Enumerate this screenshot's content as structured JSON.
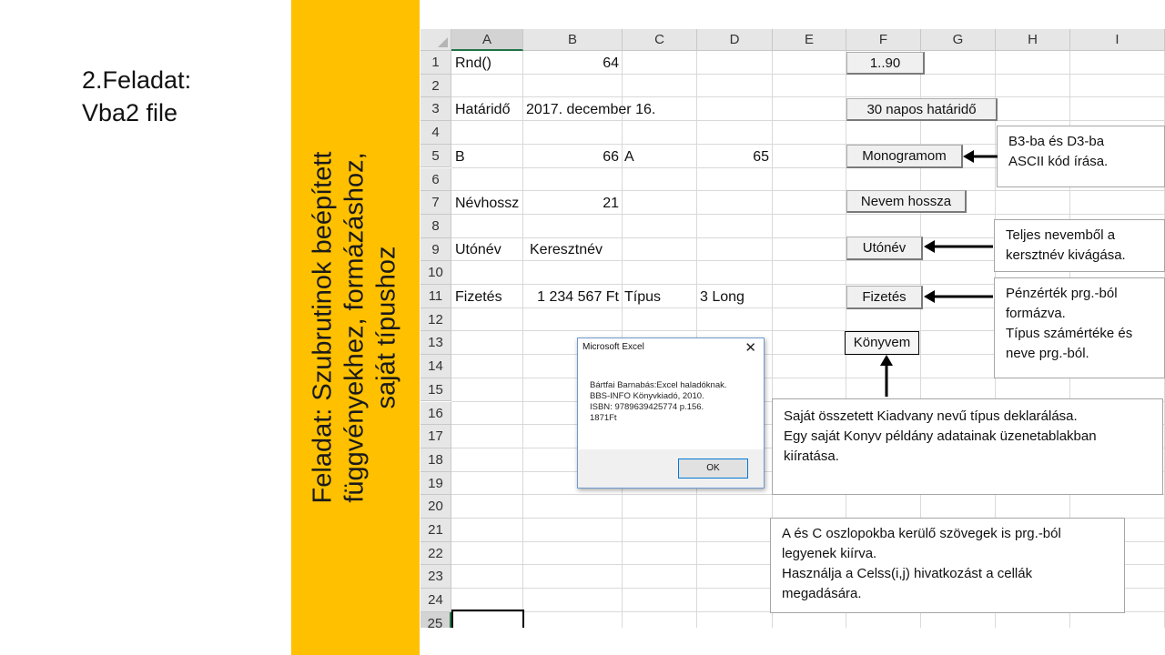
{
  "slide": {
    "title_line1": "2.Feladat:",
    "title_line2": "Vba2 file",
    "vertical_line1": "Feladat: Szubrutinok beépített",
    "vertical_line2": "függvényekhez, formázáshoz,",
    "vertical_line3": "saját típushoz",
    "band_color": "#ffc000"
  },
  "sheet": {
    "columns": [
      "A",
      "B",
      "C",
      "D",
      "E",
      "F",
      "G",
      "H",
      "I"
    ],
    "rows": [
      "1",
      "2",
      "3",
      "4",
      "5",
      "6",
      "7",
      "8",
      "9",
      "10",
      "11",
      "12",
      "13",
      "14",
      "15",
      "16",
      "17",
      "18",
      "19",
      "20",
      "21",
      "22",
      "23",
      "24",
      "25"
    ],
    "selected_column": "A",
    "selected_row": "25",
    "cells": {
      "A1": "Rnd()",
      "B1": "64",
      "A3": "Határidő",
      "B3": "2017. december 16.",
      "A5": "B",
      "B5": "66",
      "C5": "A",
      "D5": "65",
      "A7": "Névhossz",
      "B7": "21",
      "A9": "Utónév",
      "B9": "Keresztnév",
      "A11": "Fizetés",
      "B11": "1 234 567 Ft",
      "C11": "Típus",
      "D11": "3 Long"
    }
  },
  "buttons": {
    "rnd": "1..90",
    "deadline": "30 napos határidő",
    "monogram": "Monogramom",
    "name_length": "Nevem hossza",
    "first_name": "Utónév",
    "salary": "Fizetés",
    "book": "Könyvem"
  },
  "notes": {
    "ascii": [
      "B3-ba és D3-ba",
      "ASCII kód írása."
    ],
    "name_cut": [
      "Teljes nevemből a",
      "kersztnév kivágása."
    ],
    "salary": [
      "Pénzérték prg.-ból",
      "formázva.",
      "Típus számértéke és",
      "neve prg.-ból."
    ],
    "type_decl": [
      "Saját összetett  Kiadvany nevű típus deklarálása.",
      "Egy saját Konyv példány adatainak üzenetablakban",
      "kiíratása."
    ],
    "cells_note": [
      "A és C oszlopokba kerülő szövegek is prg.-ból",
      "legyenek kiírva.",
      "Használja a Celss(i,j)  hivatkozást a cellák",
      "megadására."
    ]
  },
  "dialog": {
    "title": "Microsoft Excel",
    "close": "✕",
    "body_line1": "Bártfai Barnabás:Excel haladóknak.",
    "body_line2": "BBS-INFO Könyvkiadó, 2010.",
    "body_line3": "ISBN: 9789639425774 p.156.",
    "body_line4": "1871Ft",
    "ok": "OK"
  }
}
